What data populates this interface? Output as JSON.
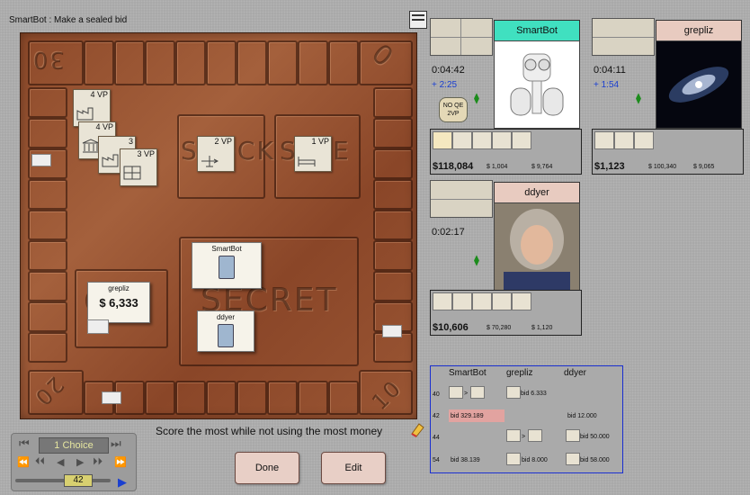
{
  "status": {
    "message": "SmartBot : Make a sealed bid"
  },
  "board": {
    "corner_labels": [
      "30",
      "20",
      "10",
      "0"
    ],
    "stock_label": "STOCK",
    "sale_label": "SALE",
    "secret_label": "SECRET",
    "cash_label": "C",
    "prompt": "Score the most while not using the most money",
    "tiles": [
      {
        "vp": "4 VP"
      },
      {
        "vp": "4 VP"
      },
      {
        "vp": "3"
      },
      {
        "vp": "3 VP"
      },
      {
        "vp": "2 VP"
      },
      {
        "vp": "1 VP"
      }
    ],
    "no_qe": {
      "line1": "NO QE",
      "line2": "2VP"
    },
    "bid_cards": {
      "grepliz": {
        "name": "grepliz",
        "amount": "$ 6,333"
      },
      "smartbot": {
        "name": "SmartBot"
      },
      "ddyer": {
        "name": "ddyer"
      }
    }
  },
  "players": [
    {
      "name": "SmartBot",
      "clock": "0:04:42",
      "bonus": "+ 2:25",
      "money": "$118,084",
      "small": [
        "$ 1,004",
        "$ 9,764"
      ],
      "color": "#40e0c0"
    },
    {
      "name": "grepliz",
      "clock": "0:04:11",
      "bonus": "+ 1:54",
      "money": "$1,123",
      "small": [
        "$ 100,340",
        "$ 9,065"
      ],
      "color": "#e8cbc0"
    },
    {
      "name": "ddyer",
      "clock": "0:02:17",
      "bonus": "",
      "money": "$10,606",
      "small": [
        "$ 70,280",
        "$ 1,120"
      ],
      "color": "#e8cbc0"
    }
  ],
  "bid_log": {
    "headers": [
      "SmartBot",
      "grepliz",
      "ddyer"
    ],
    "rows": [
      {
        "round": "40",
        "smartbot": ">",
        "grepliz": "bid 6.333",
        "ddyer": ""
      },
      {
        "round": "42",
        "smartbot": "bid 329.189",
        "grepliz": "",
        "ddyer": "bid 12.000"
      },
      {
        "round": "44",
        "smartbot": "",
        "grepliz": ">",
        "ddyer": "bid 50.000"
      },
      {
        "round": "54",
        "smartbot": "bid 38.139",
        "grepliz": "bid 8.000",
        "ddyer": "bid 58.000"
      }
    ]
  },
  "controls": {
    "choice_label": "1 Choice",
    "move_number": "42",
    "done_label": "Done",
    "edit_label": "Edit"
  },
  "colors": {
    "accent_teal": "#40e0c0",
    "player_pink": "#e8cbc0",
    "bid_highlight": "#e2a3a0",
    "log_border": "#1a2fd0"
  }
}
